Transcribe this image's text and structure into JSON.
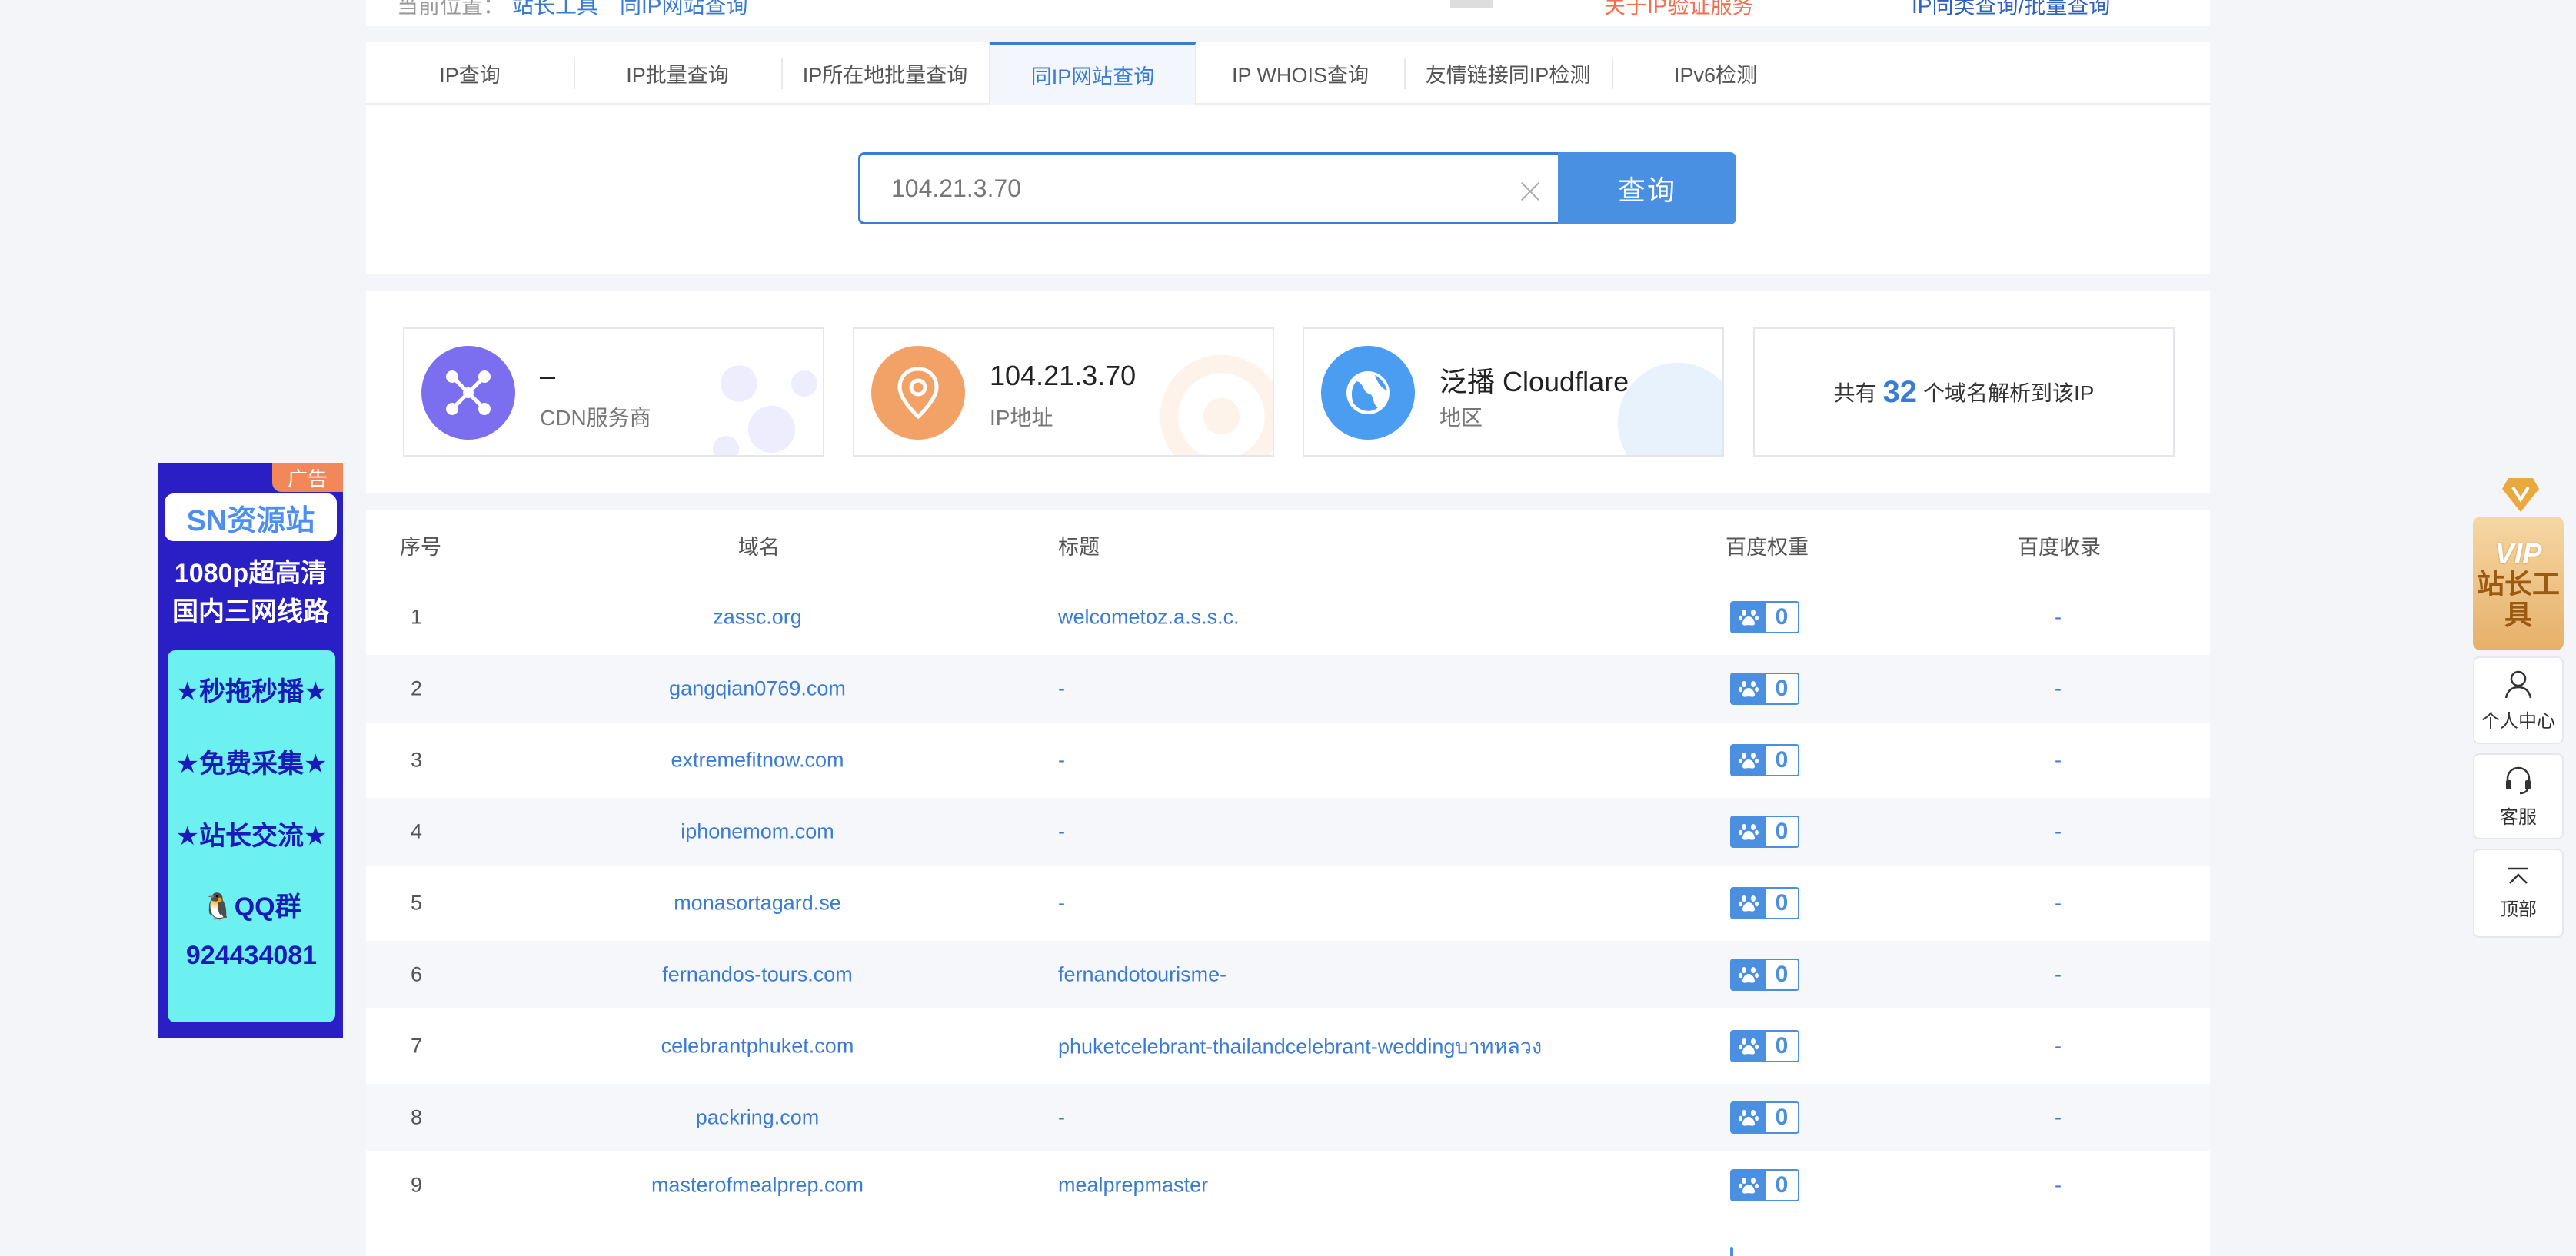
{
  "topbar": {
    "crumb_home": "当前位置：",
    "crumb_tools": "站长工具",
    "crumb_page": "同IP网站查询",
    "link_a": "关于IP验证服务",
    "link_b": "IP同类查询/批量查询"
  },
  "tabs": [
    {
      "label": "IP查询"
    },
    {
      "label": "IP批量查询"
    },
    {
      "label": "IP所在地批量查询"
    },
    {
      "label": "同IP网站查询"
    },
    {
      "label": "IP WHOIS查询"
    },
    {
      "label": "友情链接同IP检测"
    },
    {
      "label": "IPv6检测"
    }
  ],
  "search": {
    "value": "104.21.3.70",
    "button": "查询"
  },
  "cards": {
    "cdn": {
      "value": "–",
      "label": "CDN服务商"
    },
    "ip": {
      "value": "104.21.3.70",
      "label": "IP地址"
    },
    "region": {
      "value": "泛播 Cloudflare",
      "label": "地区"
    },
    "count": {
      "prefix": "共有",
      "number": "32",
      "suffix": "个域名解析到该IP"
    }
  },
  "table": {
    "headers": {
      "idx": "序号",
      "domain": "域名",
      "title": "标题",
      "weight": "百度权重",
      "index": "百度收录"
    },
    "rows": [
      {
        "idx": "1",
        "domain": "zassc.org",
        "title": "welcometoz.a.s.s.c.",
        "weight": "0",
        "index": "-"
      },
      {
        "idx": "2",
        "domain": "gangqian0769.com",
        "title": "-",
        "weight": "0",
        "index": "-"
      },
      {
        "idx": "3",
        "domain": "extremefitnow.com",
        "title": "-",
        "weight": "0",
        "index": "-"
      },
      {
        "idx": "4",
        "domain": "iphonemom.com",
        "title": "-",
        "weight": "0",
        "index": "-"
      },
      {
        "idx": "5",
        "domain": "monasortagard.se",
        "title": "-",
        "weight": "0",
        "index": "-"
      },
      {
        "idx": "6",
        "domain": "fernandos-tours.com",
        "title": "fernandotourisme-",
        "weight": "0",
        "index": "-"
      },
      {
        "idx": "7",
        "domain": "celebrantphuket.com",
        "title": "phuketcelebrant-thailandcelebrant-weddingบาทหลวง",
        "weight": "0",
        "index": "-"
      },
      {
        "idx": "8",
        "domain": "packring.com",
        "title": "-",
        "weight": "0",
        "index": "-"
      },
      {
        "idx": "9",
        "domain": "masterofmealprep.com",
        "title": "mealprepmaster",
        "weight": "0",
        "index": "-"
      }
    ]
  },
  "ad": {
    "tag": "广告",
    "logo": "SN资源站",
    "line1": "1080p超高清",
    "line2": "国内三网线路",
    "s1": "★秒拖秒播★",
    "s2": "★免费采集★",
    "s3": "★站长交流★",
    "s4": "QQ群",
    "s5": "924434081"
  },
  "side": {
    "vip_top": "VIP",
    "vip_bottom": "站长工具",
    "user_center": "个人中心",
    "service": "客服",
    "top": "顶部"
  },
  "colors": {
    "accent": "#3a7bd5",
    "button": "#4a90e2",
    "cdn_circle": "#7b6ff0",
    "ip_circle": "#f2a266",
    "region_circle": "#4a9df0"
  }
}
